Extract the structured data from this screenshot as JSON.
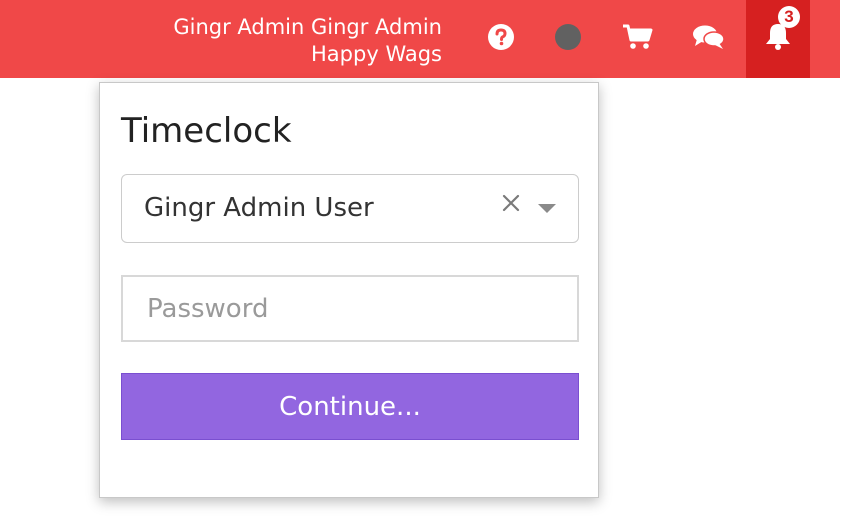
{
  "header": {
    "user_name": "Gingr Admin Gingr Admin",
    "location": "Happy Wags",
    "notification_count": "3",
    "icons": [
      "help-icon",
      "status-indicator",
      "cart-icon",
      "chat-icon",
      "bell-icon"
    ],
    "colors": {
      "bar": "#f04848",
      "notification_box": "#d62020",
      "status_dot": "#616161"
    }
  },
  "timeclock": {
    "title": "Timeclock",
    "selected_user": "Gingr Admin User",
    "password_placeholder": "Password",
    "password_value": "",
    "continue_label": "Continue...",
    "colors": {
      "continue_button": "#9266e0"
    }
  }
}
